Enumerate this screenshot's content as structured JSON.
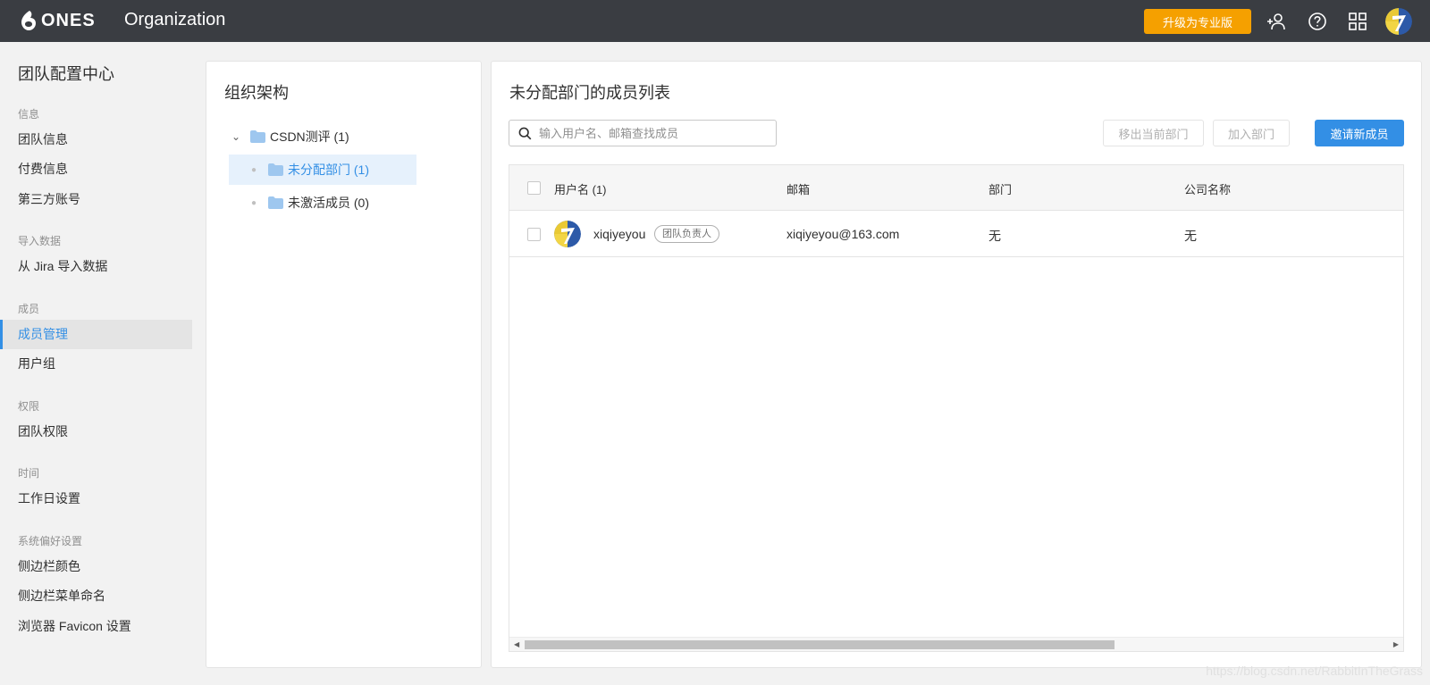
{
  "topbar": {
    "logo_text": "ONES",
    "app_title": "Organization",
    "upgrade_label": "升级为专业版",
    "icons": [
      "add-member-icon",
      "help-icon",
      "apps-grid-icon",
      "user-avatar"
    ]
  },
  "sidebar": {
    "title": "团队配置中心",
    "groups": [
      {
        "label": "信息",
        "items": [
          "团队信息",
          "付费信息",
          "第三方账号"
        ]
      },
      {
        "label": "导入数据",
        "items": [
          "从 Jira 导入数据"
        ]
      },
      {
        "label": "成员",
        "items": [
          "成员管理",
          "用户组"
        ]
      },
      {
        "label": "权限",
        "items": [
          "团队权限"
        ]
      },
      {
        "label": "时间",
        "items": [
          "工作日设置"
        ]
      },
      {
        "label": "系统偏好设置",
        "items": [
          "侧边栏颜色",
          "侧边栏菜单命名",
          "浏览器 Favicon 设置"
        ]
      }
    ],
    "active_item": "成员管理"
  },
  "org": {
    "title": "组织架构",
    "tree": {
      "root": "CSDN测评 (1)",
      "children": [
        "未分配部门 (1)",
        "未激活成员 (0)"
      ]
    }
  },
  "members": {
    "title": "未分配部门的成员列表",
    "search_placeholder": "输入用户名、邮箱查找成员",
    "btn_remove": "移出当前部门",
    "btn_join": "加入部门",
    "btn_invite": "邀请新成员",
    "columns": [
      "用户名 (1)",
      "邮箱",
      "部门",
      "公司名称"
    ],
    "rows": [
      {
        "username": "xiqiyeyou",
        "role_badge": "团队负责人",
        "email": "xiqiyeyou@163.com",
        "department": "无",
        "company": "无"
      }
    ]
  },
  "watermark": "https://blog.csdn.net/RabbitInTheGrass",
  "colors": {
    "accent": "#338fe5",
    "upgrade": "#f5a000",
    "topbar": "#3a3d42"
  }
}
